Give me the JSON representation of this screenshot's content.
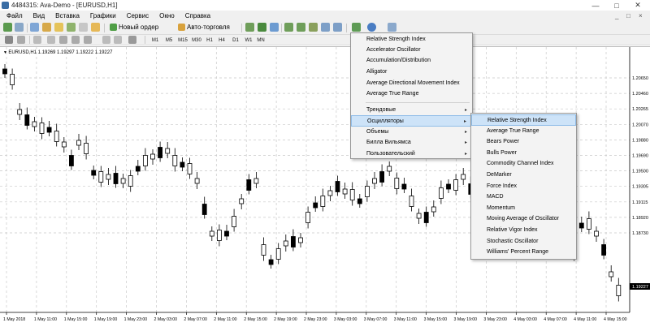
{
  "window": {
    "title": "4484315: Ava-Demo - [EURUSD,H1]",
    "minimize_glyph": "—",
    "maximize_glyph": "□",
    "close_glyph": "✕",
    "doc_minimize_glyph": "_",
    "doc_restore_glyph": "□",
    "doc_close_glyph": "×"
  },
  "menu": [
    "Файл",
    "Вид",
    "Вставка",
    "Графики",
    "Сервис",
    "Окно",
    "Справка"
  ],
  "toolbar": {
    "new_order_label": "Новый ордер",
    "autotrading_label": "Авто-торговля"
  },
  "timeframes": [
    "M1",
    "M5",
    "M15",
    "M30",
    "H1",
    "H4",
    "D1",
    "W1",
    "MN"
  ],
  "chart": {
    "symbol_line": "EURUSD,H1  1.19269 1.19297 1.19222 1.19227",
    "current_price": "1.19227",
    "price_ticks": [
      "1.20650",
      "1.20460",
      "1.20265",
      "1.20070",
      "1.19880",
      "1.19690",
      "1.19500",
      "1.19305",
      "1.19115",
      "1.18920",
      "1.18730"
    ],
    "time_ticks": [
      "1 May 2018",
      "1 May 11:00",
      "1 May 15:00",
      "1 May 19:00",
      "1 May 23:00",
      "2 May 03:00",
      "2 May 07:00",
      "2 May 11:00",
      "2 May 15:00",
      "2 May 19:00",
      "2 May 23:00",
      "3 May 03:00",
      "3 May 07:00",
      "3 May 11:00",
      "3 May 15:00",
      "3 May 19:00",
      "3 May 23:00",
      "4 May 03:00",
      "4 May 07:00",
      "4 May 11:00",
      "4 May 15:00"
    ],
    "colors": {
      "grid": "#c9c9c9",
      "candle": "#000000",
      "bull_fill": "#ffffff",
      "bear_fill": "#000000"
    }
  },
  "indicators_menu": {
    "items": [
      "Relative Strength Index",
      "Accelerator Oscillator",
      "Accumulation/Distribution",
      "Alligator",
      "Average Directional Movement Index",
      "Average True Range"
    ],
    "groups": [
      {
        "label": "Трендовые",
        "highlighted": false
      },
      {
        "label": "Осцилляторы",
        "highlighted": true
      },
      {
        "label": "Объемы",
        "highlighted": false
      },
      {
        "label": "Билла Вильямса",
        "highlighted": false
      },
      {
        "label": "Пользовательский",
        "highlighted": false
      }
    ],
    "arrow": "▸"
  },
  "oscillators_submenu": [
    {
      "label": "Relative Strength Index",
      "highlighted": true
    },
    {
      "label": "Average True Range",
      "highlighted": false
    },
    {
      "label": "Bears Power",
      "highlighted": false
    },
    {
      "label": "Bulls Power",
      "highlighted": false
    },
    {
      "label": "Commodity Channel Index",
      "highlighted": false
    },
    {
      "label": "DeMarker",
      "highlighted": false
    },
    {
      "label": "Force Index",
      "highlighted": false
    },
    {
      "label": "MACD",
      "highlighted": false
    },
    {
      "label": "Momentum",
      "highlighted": false
    },
    {
      "label": "Moving Average of Oscillator",
      "highlighted": false
    },
    {
      "label": "Relative Vigor Index",
      "highlighted": false
    },
    {
      "label": "Stochastic Oscillator",
      "highlighted": false
    },
    {
      "label": "Williams' Percent Range",
      "highlighted": false
    }
  ]
}
